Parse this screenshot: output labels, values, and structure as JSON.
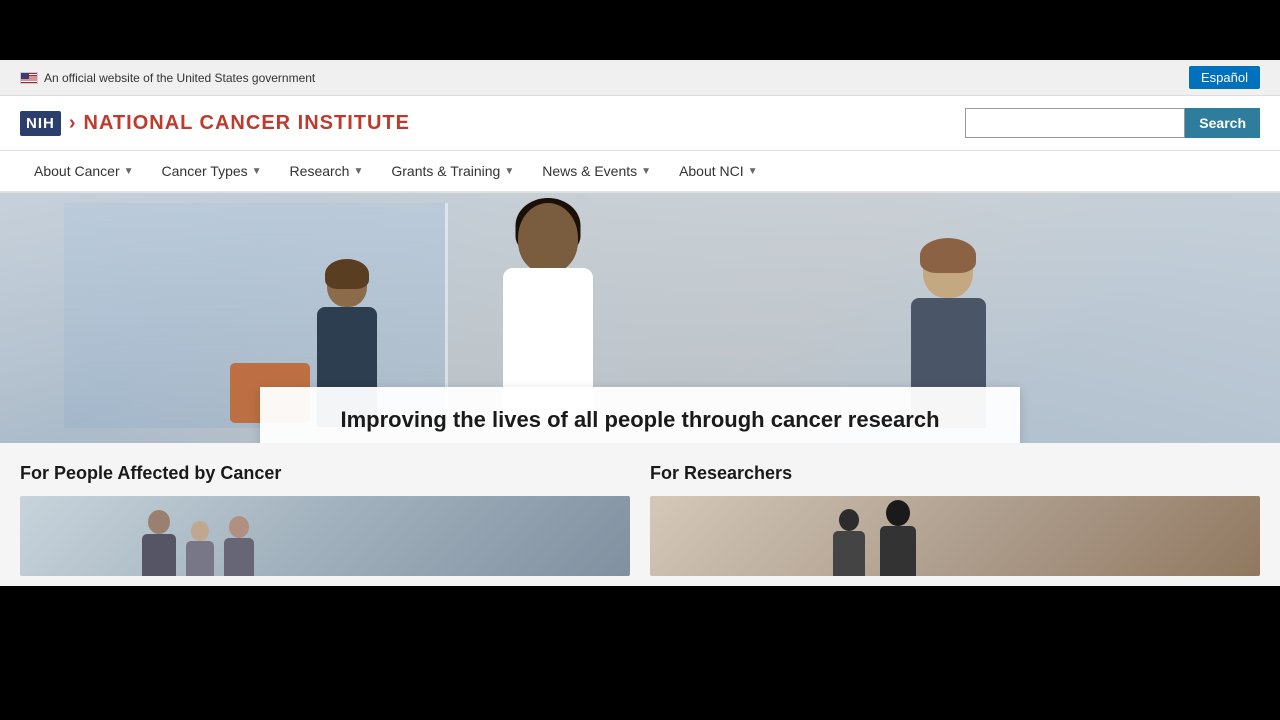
{
  "topBar": {
    "govText": "An official website of the United States government",
    "espanolLabel": "Español"
  },
  "header": {
    "nihBadge": "NIH",
    "siteTitle": "NATIONAL CANCER INSTITUTE",
    "searchPlaceholder": "",
    "searchButtonLabel": "Search"
  },
  "nav": {
    "items": [
      {
        "label": "About Cancer",
        "hasDropdown": true
      },
      {
        "label": "Cancer Types",
        "hasDropdown": true
      },
      {
        "label": "Research",
        "hasDropdown": true
      },
      {
        "label": "Grants & Training",
        "hasDropdown": true
      },
      {
        "label": "News & Events",
        "hasDropdown": true
      },
      {
        "label": "About NCI",
        "hasDropdown": true
      }
    ]
  },
  "hero": {
    "tagline": "Improving the lives of all people through cancer research"
  },
  "cards": {
    "card1": {
      "heading": "For People Affected by Cancer"
    },
    "card2": {
      "heading": "For Researchers"
    }
  }
}
